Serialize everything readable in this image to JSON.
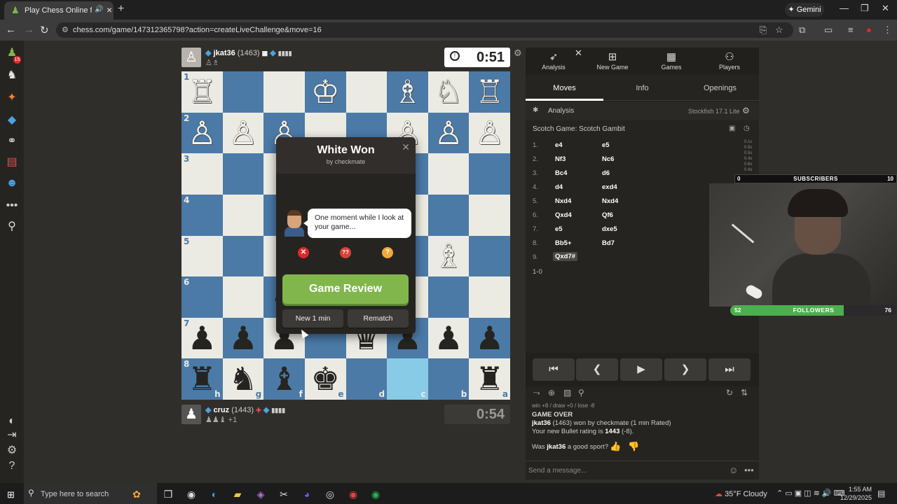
{
  "browser": {
    "tab_title": "Play Chess Online for FREE",
    "url": "chess.com/game/147312365798?action=createLiveChallenge&move=16",
    "gemini_label": "Gemini"
  },
  "top_player": {
    "name": "jkat36",
    "rating": "(1463)",
    "clock": "0:51"
  },
  "bottom_player": {
    "name": "cruz",
    "rating": "(1443)",
    "extra": "+1",
    "clock": "0:54"
  },
  "board": {
    "ranks": [
      "1",
      "2",
      "3",
      "4",
      "5",
      "6",
      "7",
      "8"
    ],
    "files": [
      "h",
      "g",
      "f",
      "e",
      "d",
      "c",
      "b",
      "a"
    ],
    "rows": [
      [
        "wR",
        "",
        "",
        "wK",
        "",
        "wB",
        "wN",
        "wR"
      ],
      [
        "wP",
        "wP",
        "wP",
        "",
        "",
        "wP",
        "wP",
        "wP"
      ],
      [
        "",
        "",
        "",
        "",
        "",
        "",
        "",
        ""
      ],
      [
        "",
        "",
        "",
        "",
        "",
        "",
        "",
        ""
      ],
      [
        "",
        "",
        "",
        "",
        "",
        "",
        "wB",
        ""
      ],
      [
        "",
        "",
        "bN",
        "",
        "",
        "",
        "",
        ""
      ],
      [
        "bP",
        "bP",
        "bP",
        "",
        "bQ",
        "bP",
        "bP",
        "bP"
      ],
      [
        "bR",
        "bN",
        "bB",
        "bK",
        "",
        "",
        "",
        "bR"
      ]
    ]
  },
  "modal": {
    "title": "White Won",
    "subtitle": "by checkmate",
    "coach_message": "One moment while I look at your game...",
    "review_label": "Game Review",
    "new_game_label": "New 1 min",
    "rematch_label": "Rematch",
    "eval_badges": [
      "✕",
      "??",
      "?"
    ],
    "colors": {
      "miss": "#e02828",
      "blunder": "#d8413a",
      "mistake": "#f0a93a",
      "accent": "#81b64c"
    }
  },
  "panel": {
    "nav": [
      {
        "label": "Analysis",
        "icon": "analysis-icon"
      },
      {
        "label": "New Game",
        "icon": "plus-icon"
      },
      {
        "label": "Games",
        "icon": "games-icon"
      },
      {
        "label": "Players",
        "icon": "players-icon"
      }
    ],
    "subtabs": [
      "Moves",
      "Info",
      "Openings"
    ],
    "analysis_label": "Analysis",
    "engine": "Stockfish 17.1 Lite",
    "opening": "Scotch Game: Scotch Gambit",
    "moves": [
      {
        "n": "1.",
        "w": "e4",
        "b": "e5"
      },
      {
        "n": "2.",
        "w": "Nf3",
        "b": "Nc6"
      },
      {
        "n": "3.",
        "w": "Bc4",
        "b": "d6"
      },
      {
        "n": "4.",
        "w": "d4",
        "b": "exd4"
      },
      {
        "n": "5.",
        "w": "Nxd4",
        "b": "Nxd4"
      },
      {
        "n": "6.",
        "w": "Qxd4",
        "b": "Qf6"
      },
      {
        "n": "7.",
        "w": "e5",
        "b": "dxe5"
      },
      {
        "n": "8.",
        "w": "Bb5+",
        "b": "Bd7"
      },
      {
        "n": "9.",
        "w": "Qxd7#",
        "b": ""
      }
    ],
    "result": "1-0",
    "chat": {
      "cut_line": "win +8 / draw +0 / lose -8",
      "game_over": "GAME OVER",
      "line1_pre": "jkat36",
      "line1_post": " (1463) won by checkmate (1 min Rated)",
      "line2_pre": "Your new Bullet rating is ",
      "line2_val": "1443",
      "line2_post": " (-8).",
      "sport_pre": "Was ",
      "sport_name": "jkat36",
      "sport_post": " a good sport?",
      "placeholder": "Send a message..."
    }
  },
  "stream": {
    "subs_current": "0",
    "subs_label": "SUBSCRIBERS",
    "subs_goal": "10",
    "followers_current": "52",
    "followers_label": "FOLLOWERS",
    "followers_goal": "76",
    "followers_progress": 0.68,
    "eval_times": [
      "0.1s",
      "0.9s",
      "0.5s",
      "0.4s",
      "0.6s",
      "0.4s"
    ]
  },
  "taskbar": {
    "search_placeholder": "Type here to search",
    "weather": "35°F  Cloudy",
    "time": "1:55 AM",
    "date": "12/29/2025"
  }
}
